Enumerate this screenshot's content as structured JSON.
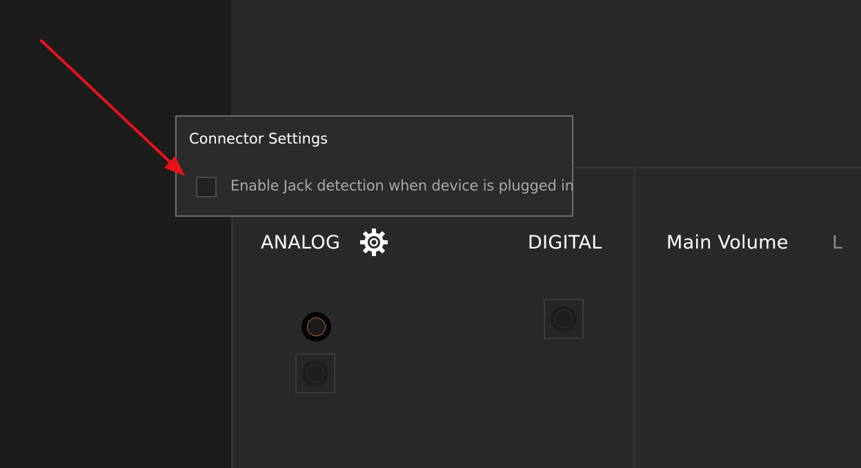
{
  "sections": {
    "analog": "ANALOG",
    "digital": "DIGITAL",
    "main_volume": "Main Volume",
    "channel_left": "L"
  },
  "popup": {
    "title": "Connector Settings",
    "checkbox_label": "Enable Jack detection when device is plugged in",
    "checkbox_checked": false
  },
  "icons": {
    "settings": "gear-icon",
    "annotation": "red-arrow"
  },
  "colors": {
    "annotation_arrow": "#e8121a",
    "jack_ring": "#b4693a"
  }
}
